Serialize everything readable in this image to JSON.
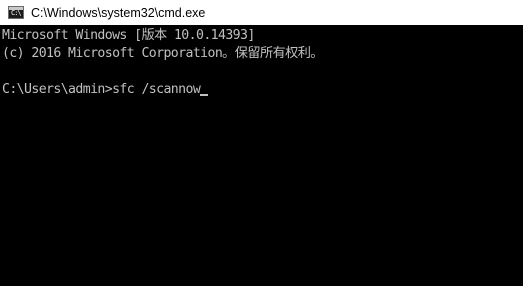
{
  "window": {
    "title": "C:\\Windows\\system32\\cmd.exe",
    "icon": "cmd-icon",
    "icon_prompt": "C:\\"
  },
  "console": {
    "lines": [
      "Microsoft Windows [版本 10.0.14393]",
      "(c) 2016 Microsoft Corporation。保留所有权利。",
      "",
      "C:\\Users\\admin>sfc /scannow"
    ],
    "text_color": "#c0c0c0",
    "background": "#000000"
  }
}
